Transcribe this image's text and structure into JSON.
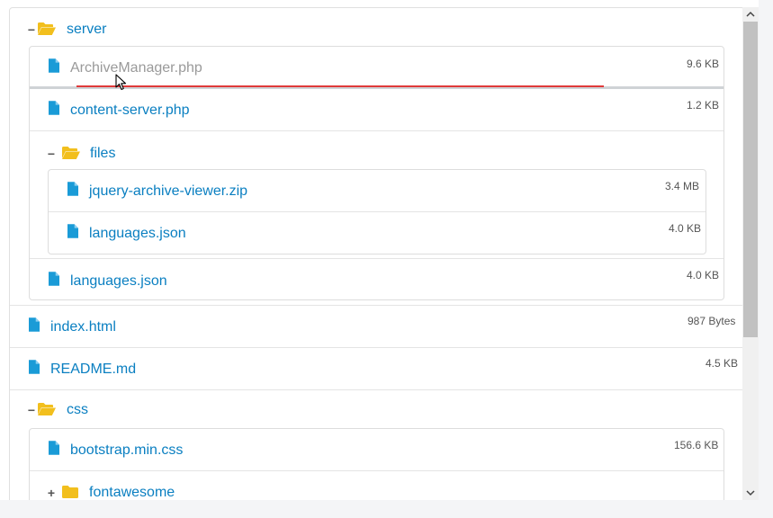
{
  "tree": {
    "server": {
      "label": "server",
      "toggle": "−",
      "icon": "folder-open-icon",
      "children": [
        {
          "name": "ArchiveManager.php",
          "size": "9.6 KB",
          "icon": "file-icon",
          "state": "dragging"
        },
        {
          "name": "content-server.php",
          "size": "1.2 KB",
          "icon": "file-icon"
        }
      ],
      "files_folder": {
        "label": "files",
        "toggle": "−",
        "icon": "folder-open-icon",
        "children": [
          {
            "name": "jquery-archive-viewer.zip",
            "size": "3.4 MB",
            "icon": "file-icon"
          },
          {
            "name": "languages.json",
            "size": "4.0 KB",
            "icon": "file-icon"
          }
        ]
      },
      "after": {
        "name": "languages.json",
        "size": "4.0 KB",
        "icon": "file-icon"
      }
    },
    "root_files": [
      {
        "name": "index.html",
        "size": "987 Bytes",
        "icon": "file-icon"
      },
      {
        "name": "README.md",
        "size": "4.5 KB",
        "icon": "file-icon"
      }
    ],
    "css": {
      "label": "css",
      "toggle": "−",
      "icon": "folder-open-icon",
      "children": [
        {
          "name": "bootstrap.min.css",
          "size": "156.6 KB",
          "icon": "file-icon"
        }
      ],
      "fontawesome": {
        "label": "fontawesome",
        "toggle": "+",
        "icon": "folder-closed-icon"
      }
    }
  },
  "colors": {
    "link": "#0a7fc1",
    "file_icon": "#1a9bd7",
    "folder_icon": "#f2bf1d",
    "drop_marker": "#e03a3a",
    "dragging_text": "#9a9a9a"
  },
  "scrollbar": {
    "position_fraction": 0.0,
    "visible_fraction": 0.68
  }
}
